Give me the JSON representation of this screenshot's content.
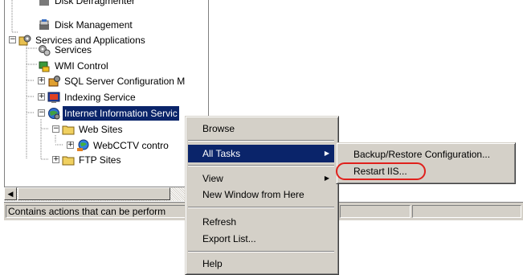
{
  "tree": {
    "items": [
      {
        "label": "Disk Defragmenter",
        "icon": "disk-defragmenter-icon"
      },
      {
        "label": "Disk Management",
        "icon": "disk-management-icon"
      },
      {
        "label": "Services and Applications",
        "icon": "services-applications-icon"
      },
      {
        "label": "Services",
        "icon": "services-gear-icon"
      },
      {
        "label": "WMI Control",
        "icon": "wmi-control-icon"
      },
      {
        "label": "SQL Server Configuration M",
        "icon": "sql-server-icon"
      },
      {
        "label": "Indexing Service",
        "icon": "indexing-service-icon"
      },
      {
        "label": "Internet Information Servic",
        "icon": "iis-icon"
      },
      {
        "label": "Web Sites",
        "icon": "folder-icon"
      },
      {
        "label": "WebCCTV contro",
        "icon": "website-globe-icon"
      },
      {
        "label": "FTP Sites",
        "icon": "folder-icon"
      }
    ]
  },
  "statusbar": {
    "text": "Contains actions that can be perform"
  },
  "context_menu": {
    "items": [
      "Browse",
      "All Tasks",
      "View",
      "New Window from Here",
      "Refresh",
      "Export List...",
      "Help"
    ],
    "highlighted": "All Tasks"
  },
  "submenu": {
    "items": [
      "Backup/Restore Configuration...",
      "Restart IIS..."
    ],
    "circled": "Restart IIS..."
  },
  "colors": {
    "selection": "#0a246a",
    "menu_face": "#d4d0c8",
    "annotation": "#e0201c"
  }
}
